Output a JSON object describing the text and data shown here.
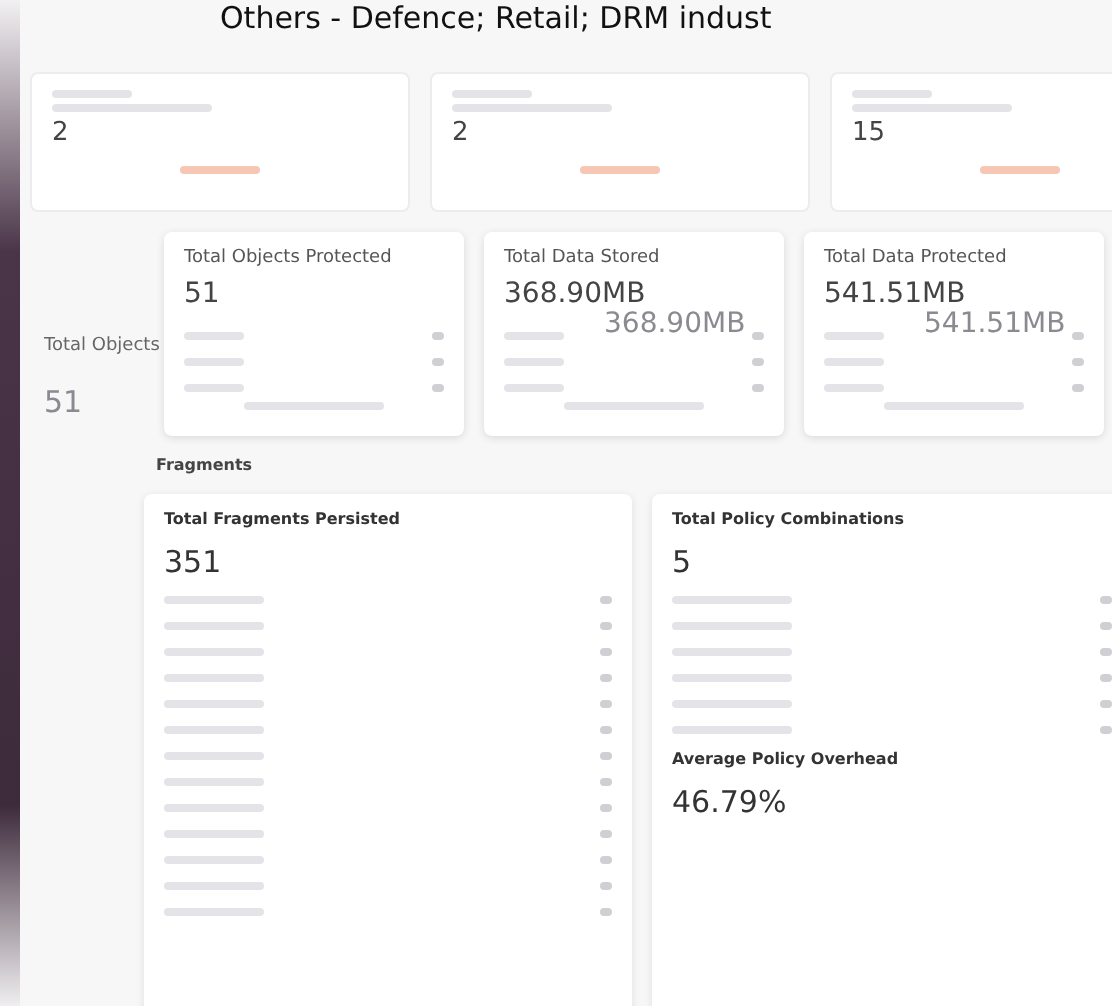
{
  "banner": "Others - Defence; Retail;  DRM indust",
  "summary_cards": [
    {
      "value": "2"
    },
    {
      "value": "2"
    },
    {
      "value": "15"
    }
  ],
  "ghost": {
    "title": "Total Objects",
    "value": "51"
  },
  "stat_cards": [
    {
      "title": "Total Objects Protected",
      "value": "51"
    },
    {
      "title": "Total Data Stored",
      "value": "368.90MB",
      "ghost_value": "368.90MB"
    },
    {
      "title": "Total Data Protected",
      "value": "541.51MB",
      "ghost_value": "541.51MB"
    }
  ],
  "section_title": "Fragments",
  "fragments_card": {
    "title": "Total Fragments Persisted",
    "value": "351"
  },
  "policy_card": {
    "title": "Total Policy Combinations",
    "value": "5",
    "overhead_title": "Average Policy Overhead",
    "overhead_value": "46.79%"
  }
}
